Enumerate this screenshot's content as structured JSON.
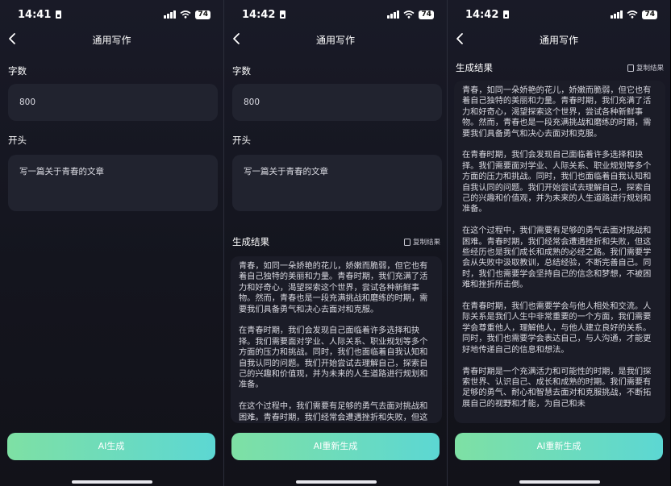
{
  "status_bar": {
    "time": "14:42",
    "first_time": "14:41",
    "battery": "74"
  },
  "nav": {
    "title": "通用写作"
  },
  "form": {
    "word_count_label": "字数",
    "word_count_value": "800",
    "opening_label": "开头",
    "opening_value": "写一篇关于青春的文章"
  },
  "result": {
    "title": "生成结果",
    "copy_label": "复制结果",
    "paragraphs": [
      "青春，如同一朵娇艳的花儿，娇嫩而脆弱，但它也有着自己独特的美丽和力量。青春时期，我们充满了活力和好奇心，渴望探索这个世界，尝试各种新鲜事物。然而，青春也是一段充满挑战和磨练的时期，需要我们具备勇气和决心去面对和克服。",
      "在青春时期，我们会发现自己面临着许多选择和抉择。我们需要面对学业、人际关系、职业规划等多个方面的压力和挑战。同时，我们也面临着自我认知和自我认同的问题。我们开始尝试去理解自己，探索自己的兴趣和价值观，并为未来的人生道路进行规划和准备。",
      "在这个过程中，我们需要有足够的勇气去面对挑战和困难。青春时期，我们经常会遭遇挫折和失败，但这些经历也是我们成长和成熟的必经之路。我们需要学会从失败中汲取教训，总结经验，不断完善自己。同时，我们也需要学会坚持自己的信念和梦想，不被困难和挫折所击倒。",
      "在青春时期，我们也需要学会与他人相处和交流。人际关系是我们人生中非常重要的一个方面，我们需要学会尊重他人，理解他人，与他人建立良好的关系。同时，我们也需要学会表达自己，与人沟通，才能更好地传递自己的信息和想法。",
      "青春时期是一个充满活力和可能性的时期，是我们探索世界、认识自己、成长和成熟的时期。我们需要有足够的勇气、耐心和智慧去面对和克服挑战，不断拓展自己的视野和才能，为自己和未"
    ]
  },
  "buttons": {
    "generate": "AI生成",
    "regenerate": "AI重新生成"
  }
}
